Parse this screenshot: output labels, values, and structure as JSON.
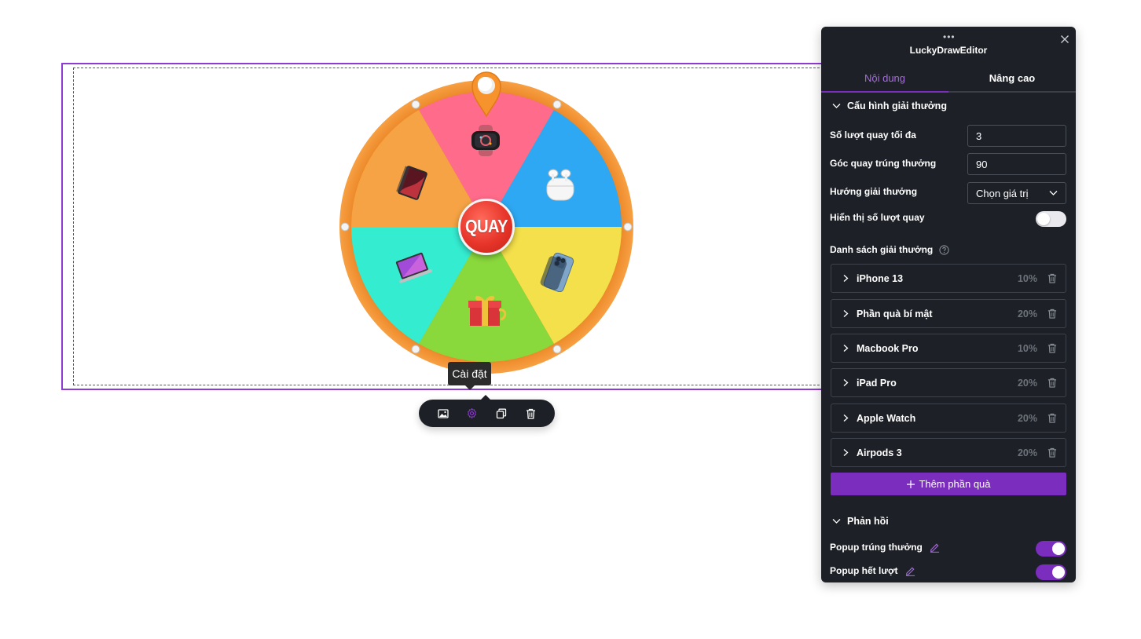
{
  "wheel": {
    "spin_label": "QUAY",
    "segments": [
      {
        "prize": "Apple Watch",
        "color": "#ff6b8a",
        "icon": "watch-icon"
      },
      {
        "prize": "Airpods 3",
        "color": "#2ea8f2",
        "icon": "airpods-icon"
      },
      {
        "prize": "iPhone 13",
        "color": "#f4e04a",
        "icon": "iphone-icon"
      },
      {
        "prize": "Phần quà bí mật",
        "color": "#8ad93c",
        "icon": "gift-icon"
      },
      {
        "prize": "Macbook Pro",
        "color": "#34ecd0",
        "icon": "macbook-icon"
      },
      {
        "prize": "iPad Pro",
        "color": "#f5a344",
        "icon": "ipad-icon"
      }
    ],
    "rim_color": "#f0912f",
    "pointer_color": "#f7932d"
  },
  "tooltip": {
    "text": "Cài đặt"
  },
  "toolbar": {
    "buttons": [
      "image-icon",
      "gear-icon",
      "duplicate-icon",
      "trash-icon"
    ],
    "active_color": "#8e3bd1"
  },
  "panel": {
    "dots": "•••",
    "title": "LuckyDrawEditor",
    "tabs": {
      "content": "Nội dung",
      "advanced": "Nâng cao"
    },
    "config_section": "Cấu hình giải thưởng",
    "fields": {
      "max_spins_label": "Số lượt quay tối đa",
      "max_spins_value": "3",
      "angle_label": "Góc quay trúng thưởng",
      "angle_value": "90",
      "direction_label": "Hướng giải thưởng",
      "direction_value": "Chọn giá trị",
      "show_spins_label": "Hiển thị số lượt quay",
      "show_spins_on": false
    },
    "prize_list_label": "Danh sách giải thưởng",
    "prizes": [
      {
        "name": "iPhone 13",
        "pct": "10%"
      },
      {
        "name": "Phần quà bí mật",
        "pct": "20%"
      },
      {
        "name": "Macbook Pro",
        "pct": "10%"
      },
      {
        "name": "iPad Pro",
        "pct": "20%"
      },
      {
        "name": "Apple Watch",
        "pct": "20%"
      },
      {
        "name": "Airpods 3",
        "pct": "20%"
      }
    ],
    "add_prize": "Thêm phần quà",
    "feedback_section": "Phản hồi",
    "popup_win_label": "Popup trúng thưởng",
    "popup_win_on": true,
    "popup_out_label": "Popup hết lượt",
    "popup_out_on": true,
    "accent": "#7b2dbd"
  }
}
